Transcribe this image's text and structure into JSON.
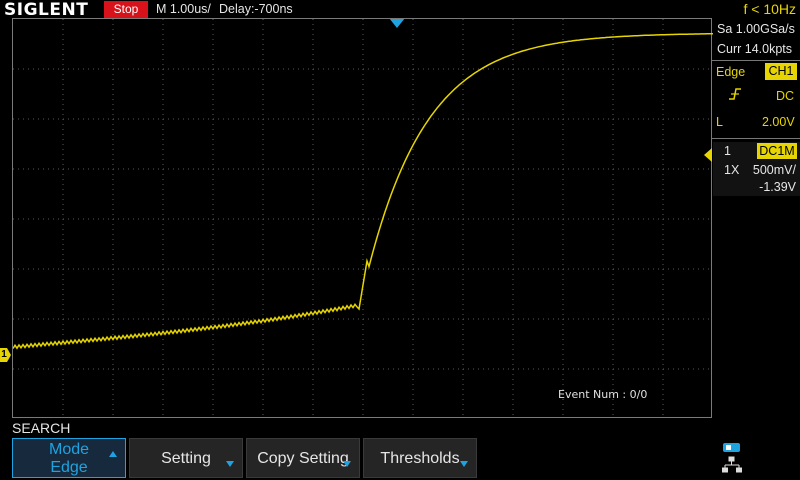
{
  "header": {
    "brand": "SIGLENT",
    "run_status": "Stop",
    "timebase": "M 1.00us/",
    "delay": "Delay:-700ns",
    "frequency": "f < 10Hz"
  },
  "acquisition": {
    "sample_rate": "Sa 1.00GSa/s",
    "memory_depth": "Curr 14.0kpts"
  },
  "trigger": {
    "type": "Edge",
    "source": "CH1",
    "slope_icon": "rising-edge-icon",
    "coupling": "DC",
    "level_label": "L",
    "level": "2.00V"
  },
  "channel": {
    "number": "1",
    "mode": "DC1M",
    "probe": "1X",
    "scale": "500mV/",
    "offset": "-1.39V",
    "ground_marker": "1"
  },
  "display": {
    "event_num": "Event Num : 0/0",
    "trace_color": "#e6d500",
    "grid_color": "#5a5a5a",
    "accent": "#1fa3e0"
  },
  "menu": {
    "title": "SEARCH",
    "mode_line1": "Mode",
    "mode_line2": "Edge",
    "setting": "Setting",
    "copy_setting": "Copy Setting",
    "thresholds": "Thresholds"
  },
  "status_icons": [
    "usb-icon",
    "network-icon"
  ]
}
